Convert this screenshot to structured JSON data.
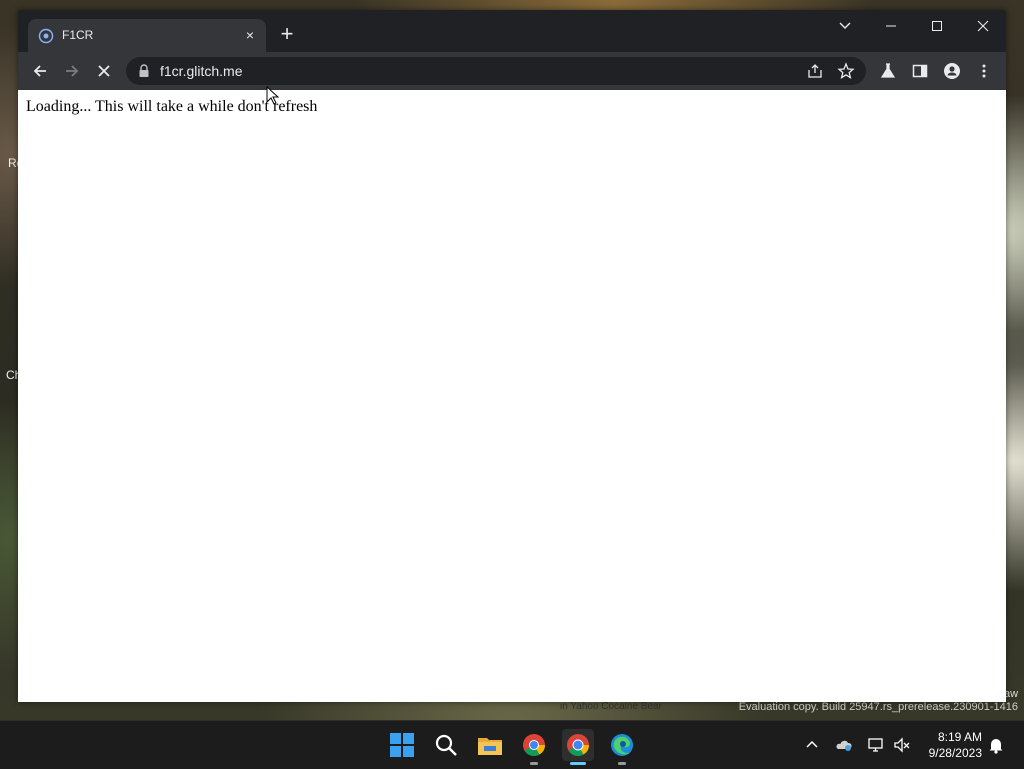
{
  "browser": {
    "tab": {
      "title": "F1CR",
      "close_glyph": "×",
      "favicon": "globe-icon"
    },
    "new_tab_glyph": "+",
    "address": {
      "url": "f1cr.glitch.me"
    }
  },
  "page": {
    "text": "Loading... This will take a while don't refresh"
  },
  "desktop": {
    "side_labels": [
      "Re",
      "Ch"
    ],
    "watermark": "Evaluation copy. Build 25947.rs_prerelease.230901-1416",
    "corner_text": "aw",
    "wallpaper_caption": "in Yahoo Cocaine Bear"
  },
  "taskbar": {
    "apps": [
      "windows-start-icon",
      "search-icon",
      "file-explorer-icon",
      "chrome-icon",
      "chrome-dev-icon",
      "edge-icon"
    ],
    "clock": {
      "time": "8:19 AM",
      "date": "9/28/2023"
    }
  },
  "colors": {
    "titlebar": "#202124",
    "toolbar": "#35363a",
    "omnibox": "#202124",
    "taskbar": "#1c1c1c",
    "accent": "#60cdff"
  }
}
